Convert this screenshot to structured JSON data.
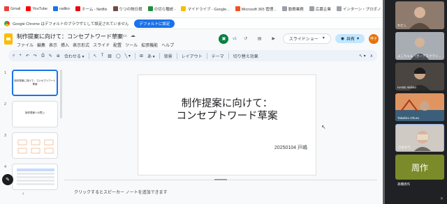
{
  "bookmarks": [
    {
      "label": "Gmail",
      "icon": "gmail-icon",
      "color": "#ea4335"
    },
    {
      "label": "YouTube",
      "icon": "youtube-icon",
      "color": "#ff0000"
    },
    {
      "label": "radiko",
      "icon": "radiko-icon",
      "color": "#1a73e8"
    },
    {
      "label": "ホーム - Netflix",
      "icon": "netflix-icon",
      "color": "#e50914"
    },
    {
      "label": "りつの物日樽",
      "icon": "bookmark-icon",
      "color": "#6d4c41"
    },
    {
      "label": "の切ら種説 -",
      "icon": "bookmark-icon",
      "color": "#1e8e3e"
    },
    {
      "label": "マイドライブ - Google...",
      "icon": "drive-icon",
      "color": "#fbbc04"
    },
    {
      "label": "Microsoft 365 管理...",
      "icon": "microsoft-icon",
      "color": "#f25022"
    },
    {
      "label": "勤務業務",
      "icon": "folder-icon",
      "color": "#9aa0a6"
    },
    {
      "label": "応募企業",
      "icon": "folder-icon",
      "color": "#9aa0a6"
    },
    {
      "label": "インターン・プロボノ",
      "icon": "folder-icon",
      "color": "#9aa0a6"
    }
  ],
  "infobar": {
    "message": "Google Chrome はデフォルトのブラウザとして設定されていません",
    "button": "デフォルトに設定"
  },
  "header": {
    "title": "制作提案に向けて：コンセプトワード草案",
    "menu": [
      "ファイル",
      "編集",
      "表示",
      "挿入",
      "表示形式",
      "スライド",
      "配置",
      "ツール",
      "拡張機能",
      "ヘルプ"
    ],
    "version": "v1",
    "slideshow": "スライドショー",
    "share": "共有",
    "avatar": "梓子"
  },
  "toolbar": {
    "fit": "合わせる",
    "background": "背景",
    "layout": "レイアウト",
    "theme": "テーマ",
    "transition": "切り替え効果"
  },
  "filmstrip": [
    {
      "num": "1",
      "title": "制作提案に向けて：コンセプトワード草案"
    },
    {
      "num": "2",
      "title": "制作提案への思い"
    },
    {
      "num": "3",
      "title": ""
    },
    {
      "num": "4",
      "title": ""
    }
  ],
  "slide": {
    "title_line1": "制作提案に向けて：",
    "title_line2": "コンセプトワード草案",
    "subtitle": "20250104 戸嶋"
  },
  "notes": {
    "placeholder": "クリックするとスピーカー ノートを追加できます"
  },
  "participants": [
    {
      "name": "わたし",
      "bg": "#6b5a4e"
    },
    {
      "name": "よこちゃん（ガーデスクラシ...",
      "bg": "#8a8f96"
    },
    {
      "name": "HASE Akihiro",
      "bg": "#3a3a3a"
    },
    {
      "name": "Takahiro Ohura",
      "bg": "#c56a3a"
    },
    {
      "name": "ひまわり",
      "bg": "#b9b4ad"
    },
    {
      "name": "周作",
      "bg": "#7b8b2a",
      "label": "周作",
      "caption": "髙橋周作"
    }
  ]
}
